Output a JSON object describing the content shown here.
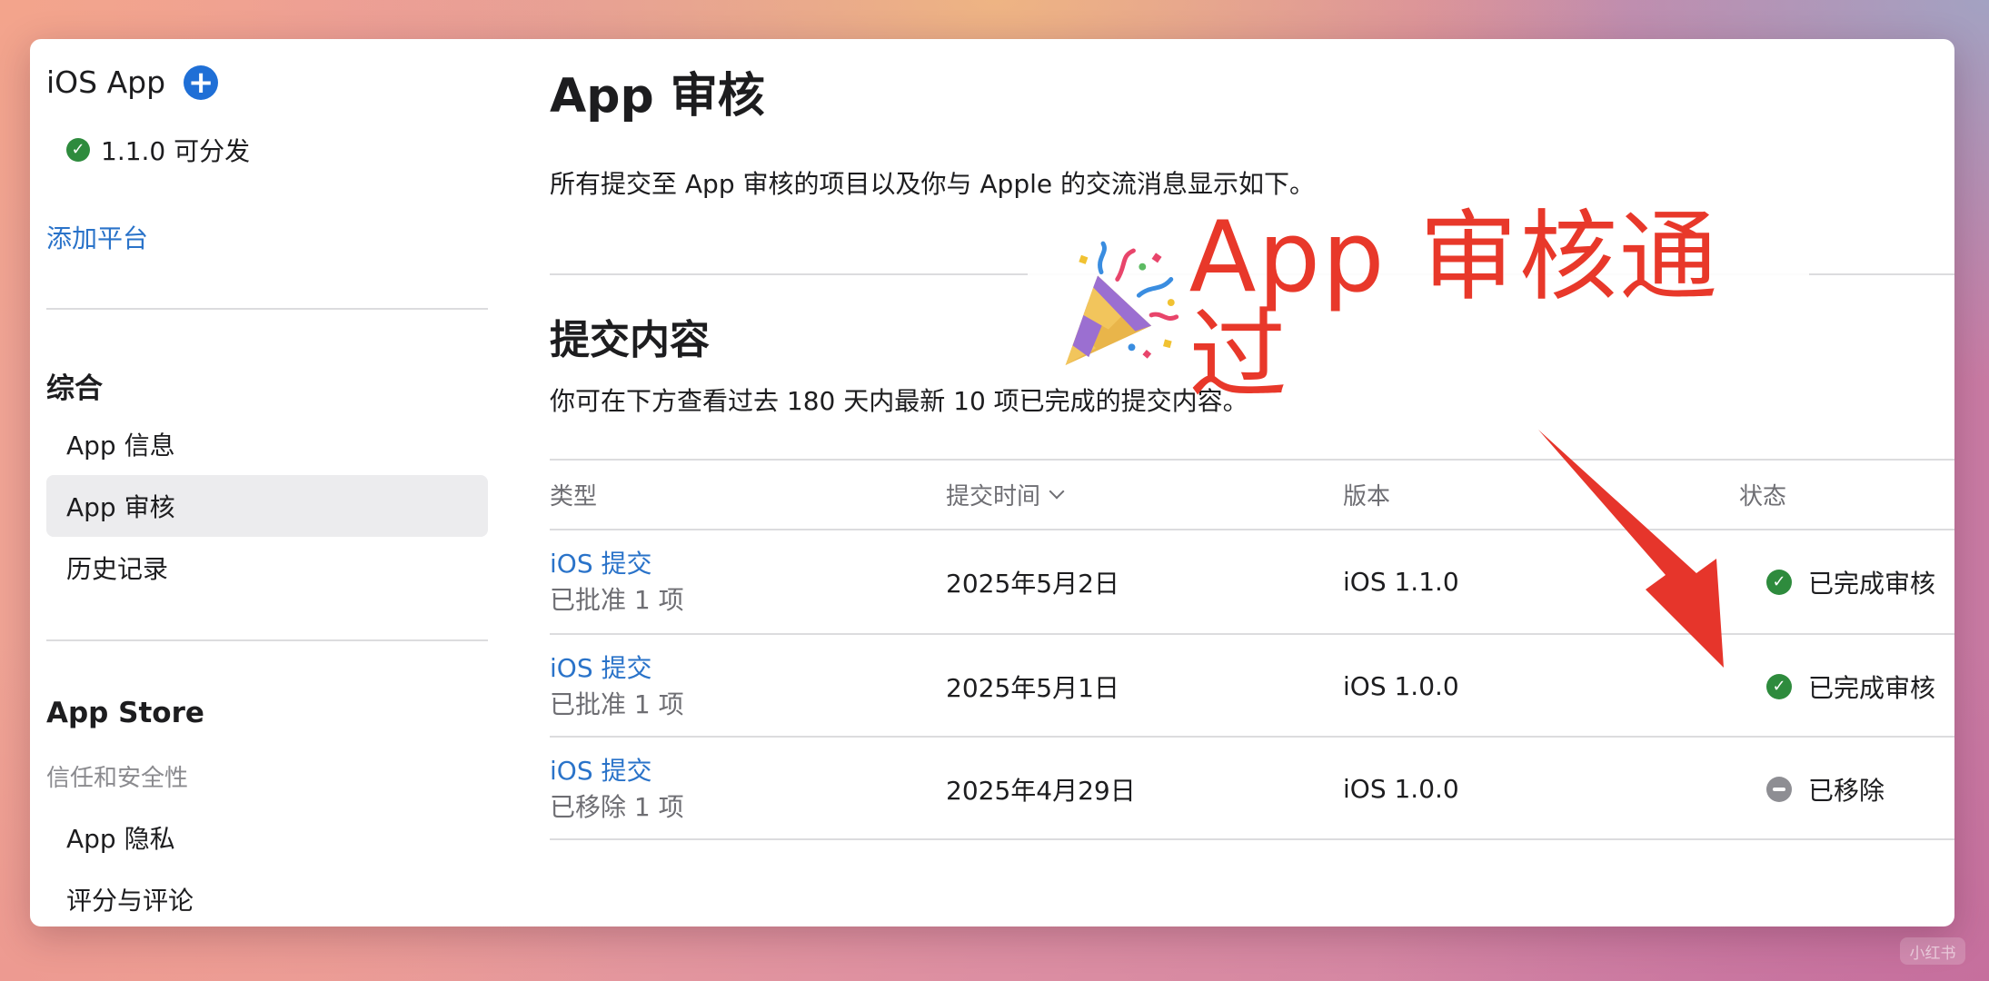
{
  "sidebar": {
    "app_title": "iOS App",
    "add_button_icon": "+",
    "version_status": "1.1.0 可分发",
    "add_platform": "添加平台",
    "general_title": "综合",
    "general_items": [
      "App 信息",
      "App 审核",
      "历史记录"
    ],
    "active_item": "App 审核",
    "store_title": "App Store",
    "trust_label": "信任和安全性",
    "store_items": [
      "App 隐私",
      "评分与评论"
    ]
  },
  "main": {
    "title": "App 审核",
    "description": "所有提交至 App 审核的项目以及你与 Apple 的交流消息显示如下。",
    "submissions_title": "提交内容",
    "submissions_desc": "你可在下方查看过去 180 天内最新 10 项已完成的提交内容。",
    "columns": [
      "类型",
      "提交时间",
      "版本",
      "状态"
    ],
    "sort_column": "提交时间",
    "rows": [
      {
        "type": "iOS 提交",
        "detail": "已批准 1 项",
        "date": "2025年5月2日",
        "version": "iOS 1.1.0",
        "status": "已完成审核",
        "status_icon": "check-circle-icon"
      },
      {
        "type": "iOS 提交",
        "detail": "已批准 1 项",
        "date": "2025年5月1日",
        "version": "iOS 1.0.0",
        "status": "已完成审核",
        "status_icon": "check-circle-icon"
      },
      {
        "type": "iOS 提交",
        "detail": "已移除 1 项",
        "date": "2025年4月29日",
        "version": "iOS 1.0.0",
        "status": "已移除",
        "status_icon": "minus-circle-icon"
      }
    ]
  },
  "annotation": {
    "text": "App 审核通过",
    "icon": "party-popper-icon",
    "color": "#e8382a"
  },
  "watermark": "小红书",
  "colors": {
    "link": "#2a73c9",
    "success": "#2e8b3d",
    "removed": "#8e8e93",
    "accent_button": "#1f6fd6"
  }
}
